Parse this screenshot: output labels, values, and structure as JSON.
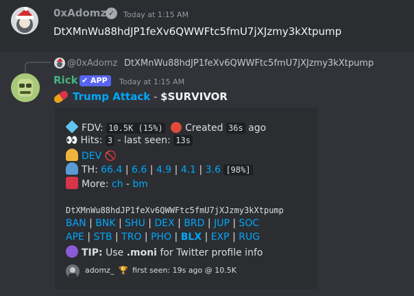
{
  "message1": {
    "username": "0xAdomz",
    "timestamp": "Today at 1:15 AM",
    "text": "DtXMnWu88hdJP1feXv6QWWFtc5fmU7jXJzmy3kXtpump"
  },
  "reply": {
    "username": "@0xAdomz",
    "text": "DtXMnWu88hdJP1feXv6QWWFtc5fmU7jXJzmy3kXtpump"
  },
  "message2": {
    "username": "Rick",
    "badge": "APP",
    "timestamp": "Today at 1:15 AM",
    "title_link": "Trump Attack",
    "title_sep": " - ",
    "title_ticker": "$SURVIVOR"
  },
  "embed": {
    "fdv_label": "FDV:",
    "fdv_value": "10.5K (15%)",
    "created_label": "Created",
    "created_value": "36s",
    "created_suffix": "ago",
    "hits_label": "Hits:",
    "hits_value": "3",
    "last_seen_label": "- last seen:",
    "last_seen_value": "13s",
    "dev_label": "DEV",
    "th_label": "TH:",
    "th_values": [
      "66.4",
      "6.6",
      "4.9",
      "4.1",
      "3.6"
    ],
    "th_total": "[98%]",
    "more_label": "More:",
    "more_links": [
      "ch",
      "bm"
    ],
    "address": "DtXMnWu88hdJP1feXv6QWWFtc5fmU7jXJzmy3kXtpump",
    "links_row1": [
      "BAN",
      "BNK",
      "SHU",
      "DEX",
      "BRD",
      "JUP",
      "SOC"
    ],
    "links_row2": [
      "APE",
      "STB",
      "TRO",
      "PHO",
      "BLX",
      "EXP",
      "RUG"
    ],
    "tip_label": "TIP:",
    "tip_text1": "Use",
    "tip_cmd": ".moni",
    "tip_text2": "for Twitter profile info",
    "footer_user": "adomz_",
    "footer_text": "first seen: 19s ago @ 10.5K"
  },
  "colors": {
    "background": "#313338",
    "highlight": "#2b2d31",
    "link": "#00a8fc",
    "app_badge": "#5865f2",
    "rick_name": "#43b581"
  },
  "icons": [
    "santa-avatar",
    "verified-icon",
    "rick-avatar",
    "pill-icon",
    "gem-icon",
    "alarm-clock-icon",
    "eyes-icon",
    "developer-icon",
    "no-entry-icon",
    "people-icon",
    "keyboard-icon",
    "eye-icon",
    "trophy-icon"
  ]
}
